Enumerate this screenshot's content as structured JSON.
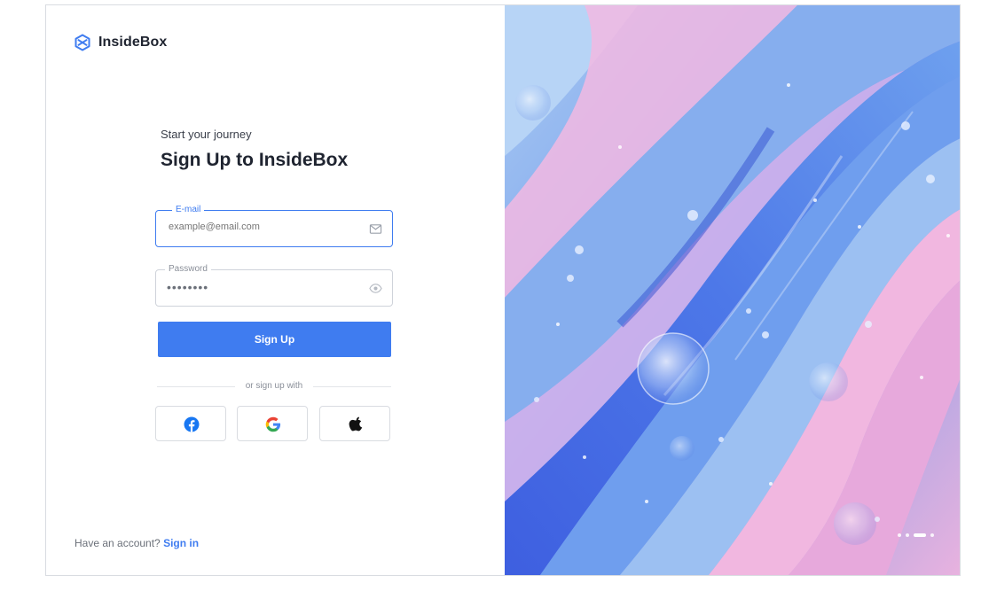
{
  "brand": {
    "name": "InsideBox",
    "icon": "cube-logo-icon",
    "accent": "#3f7cf0"
  },
  "form": {
    "subtitle": "Start your journey",
    "title": "Sign Up to InsideBox",
    "email": {
      "label": "E-mail",
      "placeholder": "example@email.com",
      "icon": "mail-icon"
    },
    "password": {
      "label": "Password",
      "value": "••••••••",
      "icon": "eye-icon"
    },
    "submit_label": "Sign Up",
    "divider_text": "or sign up with",
    "social": [
      {
        "name": "facebook",
        "icon": "facebook-icon"
      },
      {
        "name": "google",
        "icon": "google-icon"
      },
      {
        "name": "apple",
        "icon": "apple-icon"
      }
    ]
  },
  "footer": {
    "prompt": "Have an account?",
    "link": "Sign in"
  },
  "carousel": {
    "slides": 4,
    "active_index": 2
  }
}
